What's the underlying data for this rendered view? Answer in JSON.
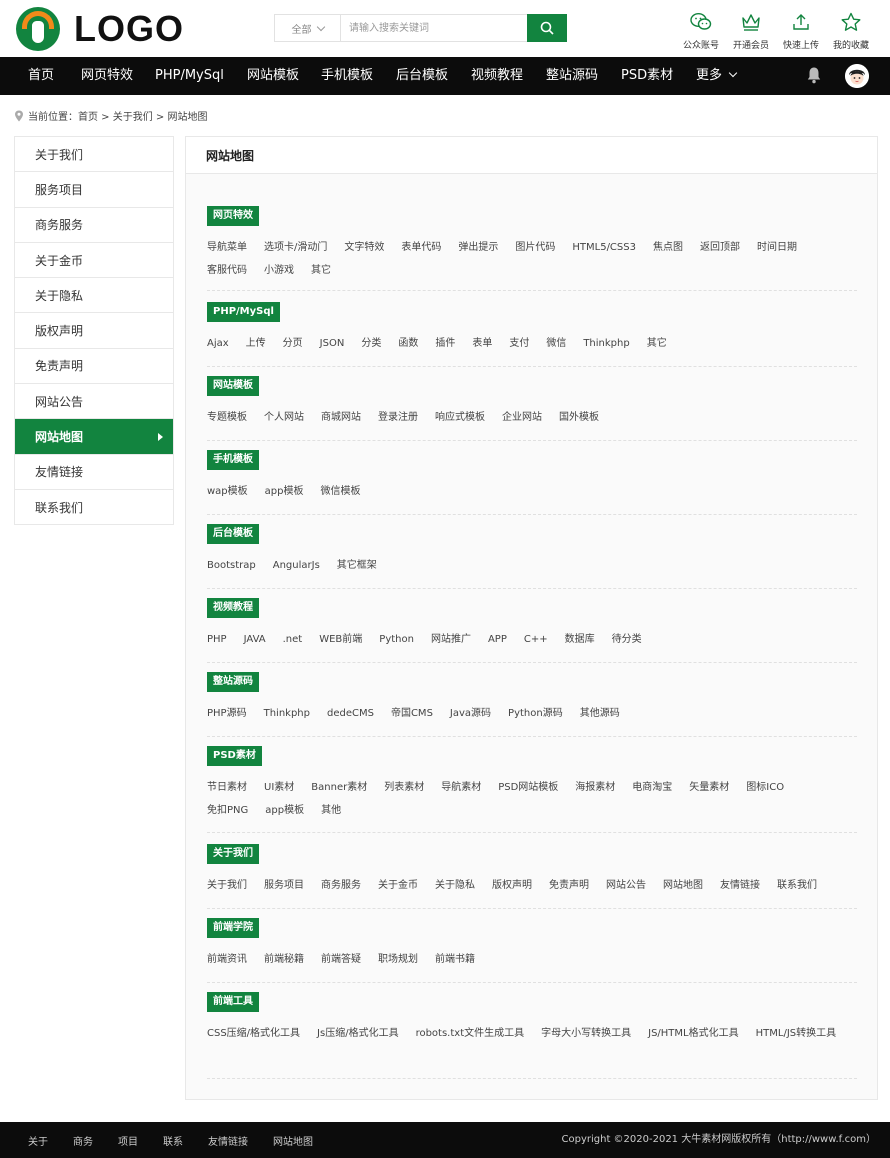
{
  "logo": {
    "text": "LOGO"
  },
  "search": {
    "category": "全部",
    "placeholder": "请输入搜索关键词"
  },
  "tools": [
    {
      "label": "公众账号",
      "icon": "wechat-icon"
    },
    {
      "label": "开通会员",
      "icon": "crown-icon"
    },
    {
      "label": "快速上传",
      "icon": "upload-icon"
    },
    {
      "label": "我的收藏",
      "icon": "star-icon"
    }
  ],
  "nav": [
    "首页",
    "网页特效",
    "PHP/MySql",
    "网站模板",
    "手机模板",
    "后台模板",
    "视频教程",
    "整站源码",
    "PSD素材",
    "更多"
  ],
  "breadcrumb": "当前位置：首页 > 关于我们 > 网站地图",
  "sidebar": [
    "关于我们",
    "服务项目",
    "商务服务",
    "关于金币",
    "关于隐私",
    "版权声明",
    "免责声明",
    "网站公告",
    "网站地图",
    "友情链接",
    "联系我们"
  ],
  "sidebar_active": "网站地图",
  "main_title": "网站地图",
  "sections": [
    {
      "title": "网页特效",
      "links": [
        "导航菜单",
        "选项卡/滑动门",
        "文字特效",
        "表单代码",
        "弹出提示",
        "图片代码",
        "HTML5/CSS3",
        "焦点图",
        "返回顶部",
        "时间日期",
        "客服代码",
        "小游戏",
        "其它"
      ]
    },
    {
      "title": "PHP/MySql",
      "links": [
        "Ajax",
        "上传",
        "分页",
        "JSON",
        "分类",
        "函数",
        "插件",
        "表单",
        "支付",
        "微信",
        "Thinkphp",
        "其它"
      ]
    },
    {
      "title": "网站模板",
      "links": [
        "专题模板",
        "个人网站",
        "商城网站",
        "登录注册",
        "响应式模板",
        "企业网站",
        "国外模板"
      ]
    },
    {
      "title": "手机模板",
      "links": [
        "wap模板",
        "app模板",
        "微信模板"
      ]
    },
    {
      "title": "后台模板",
      "links": [
        "Bootstrap",
        "AngularJs",
        "其它框架"
      ]
    },
    {
      "title": "视频教程",
      "links": [
        "PHP",
        "JAVA",
        ".net",
        "WEB前端",
        "Python",
        "网站推广",
        "APP",
        "C++",
        "数据库",
        "待分类"
      ]
    },
    {
      "title": "整站源码",
      "links": [
        "PHP源码",
        "Thinkphp",
        "dedeCMS",
        "帝国CMS",
        "Java源码",
        "Python源码",
        "其他源码"
      ]
    },
    {
      "title": "PSD素材",
      "links": [
        "节日素材",
        "UI素材",
        "Banner素材",
        "列表素材",
        "导航素材",
        "PSD网站模板",
        "海报素材",
        "电商淘宝",
        "矢量素材",
        "图标ICO",
        "免扣PNG",
        "app模板",
        "其他"
      ]
    },
    {
      "title": "关于我们",
      "links": [
        "关于我们",
        "服务项目",
        "商务服务",
        "关于金币",
        "关于隐私",
        "版权声明",
        "免责声明",
        "网站公告",
        "网站地图",
        "友情链接",
        "联系我们"
      ]
    },
    {
      "title": "前端学院",
      "links": [
        "前端资讯",
        "前端秘籍",
        "前端答疑",
        "职场规划",
        "前端书籍"
      ]
    },
    {
      "title": "前端工具",
      "links": [
        "CSS压缩/格式化工具",
        "Js压缩/格式化工具",
        "robots.txt文件生成工具",
        "字母大小写转换工具",
        "JS/HTML格式化工具",
        "HTML/JS转换工具"
      ]
    }
  ],
  "footer": {
    "links": [
      "关于",
      "商务",
      "项目",
      "联系",
      "友情链接",
      "网站地图"
    ],
    "copyright": "Copyright ©2020-2021 大牛素材网版权所有（http://www.f.com）"
  },
  "colors": {
    "brand": "#12843f",
    "nav_bg": "#0c0c0c",
    "accent_orange": "#f28a1a"
  }
}
